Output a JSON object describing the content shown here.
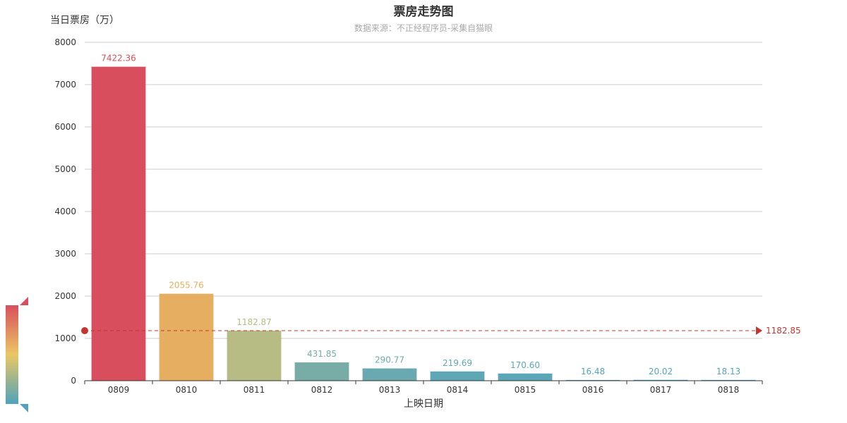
{
  "chart_data": {
    "type": "bar",
    "title": "票房走势图",
    "subtitle": "数据来源：不正经程序员-采集自猫眼",
    "ylabel": "当日票房（万）",
    "xlabel": "上映日期",
    "categories": [
      "0809",
      "0810",
      "0811",
      "0812",
      "0813",
      "0814",
      "0815",
      "0816",
      "0817",
      "0818"
    ],
    "values": [
      7422.36,
      2055.76,
      1182.87,
      431.85,
      290.77,
      219.69,
      170.6,
      16.48,
      20.02,
      18.13
    ],
    "value_labels": [
      "7422.36",
      "2055.76",
      "1182.87",
      "431.85",
      "290.77",
      "219.69",
      "170.60",
      "16.48",
      "20.02",
      "18.13"
    ],
    "ylim": [
      0,
      8000
    ],
    "yticks": [
      "0",
      "1000",
      "2000",
      "3000",
      "4000",
      "5000",
      "6000",
      "7000",
      "8000"
    ],
    "grid": true,
    "mark_line": {
      "value": 1182.85,
      "label": "1182.85",
      "style": "dashed"
    },
    "visual_map": {
      "position": "left-bottom",
      "colors": [
        "#d94e5d",
        "#eac763",
        "#50a3ba"
      ]
    },
    "bar_colors": [
      "#d94e5d",
      "#e6ae60",
      "#b6bc83",
      "#78aca7",
      "#6aa9b0",
      "#5ea7b5",
      "#5ba6b7",
      "#55a4b9",
      "#55a4b9",
      "#55a4b9"
    ]
  }
}
